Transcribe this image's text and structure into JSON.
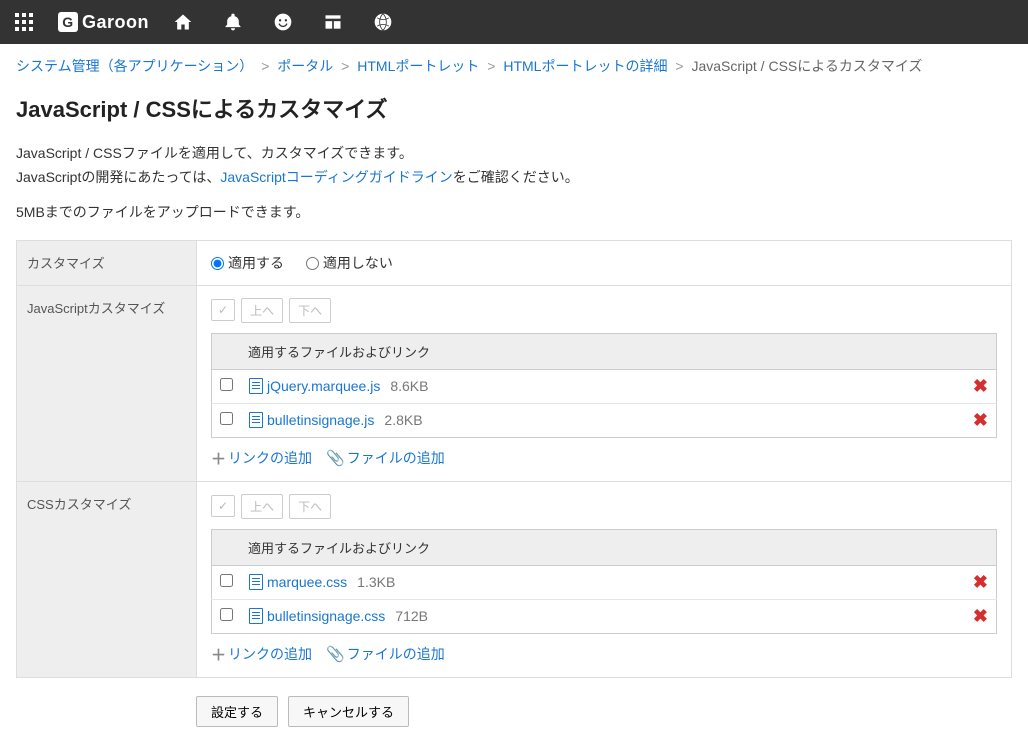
{
  "header": {
    "product": "Garoon"
  },
  "breadcrumb": {
    "items": [
      {
        "label": "システム管理（各アプリケーション）",
        "link": true
      },
      {
        "label": "ポータル",
        "link": true
      },
      {
        "label": "HTMLポートレット",
        "link": true
      },
      {
        "label": "HTMLポートレットの詳細",
        "link": true
      },
      {
        "label": "JavaScript / CSSによるカスタマイズ",
        "link": false
      }
    ]
  },
  "page": {
    "title": "JavaScript / CSSによるカスタマイズ",
    "intro_line1": "JavaScript / CSSファイルを適用して、カスタマイズできます。",
    "intro_line2_pre": "JavaScriptの開発にあたっては、",
    "intro_link": "JavaScriptコーディングガイドライン",
    "intro_line2_post": "をご確認ください。",
    "upload_note": "5MBまでのファイルをアップロードできます。"
  },
  "labels": {
    "customize": "カスタマイズ",
    "js_customize": "JavaScriptカスタマイズ",
    "css_customize": "CSSカスタマイズ",
    "apply_on": "適用する",
    "apply_off": "適用しない",
    "move_up": "上へ",
    "move_down": "下へ",
    "file_header": "適用するファイルおよびリンク",
    "add_link": "リンクの追加",
    "add_file": "ファイルの追加",
    "submit": "設定する",
    "cancel": "キャンセルする"
  },
  "js_files": [
    {
      "name": "jQuery.marquee.js",
      "size": "8.6KB"
    },
    {
      "name": "bulletinsignage.js",
      "size": "2.8KB"
    }
  ],
  "css_files": [
    {
      "name": "marquee.css",
      "size": "1.3KB"
    },
    {
      "name": "bulletinsignage.css",
      "size": "712B"
    }
  ]
}
